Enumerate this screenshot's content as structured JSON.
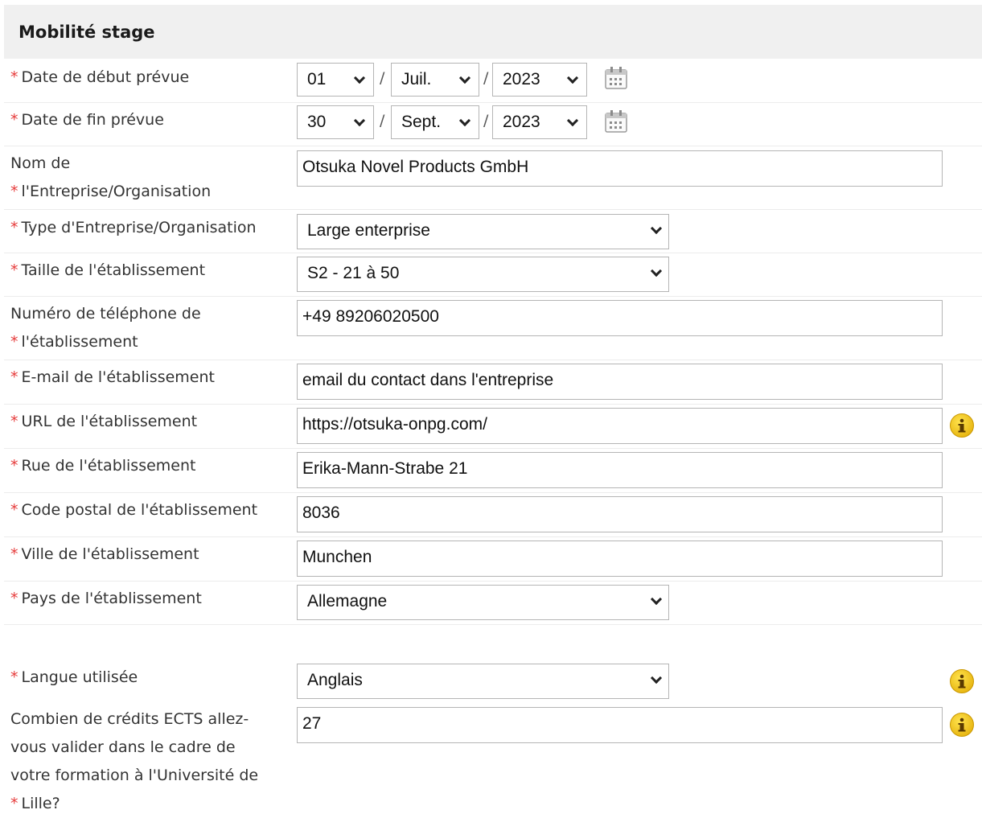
{
  "section": {
    "title": "Mobilité stage"
  },
  "colors": {
    "required": "#e63c3c",
    "info": "#f5c000",
    "header_bg": "#f0f0f0"
  },
  "fields": {
    "start_date": {
      "label": "Date de début prévue",
      "required": true,
      "day": "01",
      "month": "Juil.",
      "year": "2023",
      "sep": "/"
    },
    "end_date": {
      "label": "Date de fin prévue",
      "required": true,
      "day": "30",
      "month": "Sept.",
      "year": "2023",
      "sep": "/"
    },
    "org_name": {
      "label_line1": "Nom de",
      "label_line2": "l'Entreprise/Organisation",
      "required": true,
      "value": "Otsuka Novel Products GmbH"
    },
    "org_type": {
      "label": "Type d'Entreprise/Organisation",
      "required": true,
      "value": "Large enterprise"
    },
    "size": {
      "label": "Taille de l'établissement",
      "required": true,
      "value": "S2 - 21 à 50"
    },
    "phone": {
      "label_line1": "Numéro de téléphone de",
      "label_line2": "l'établissement",
      "required": true,
      "value": "+49 89206020500"
    },
    "email": {
      "label": "E-mail de l'établissement",
      "required": true,
      "value": "email du contact dans l'entreprise"
    },
    "url": {
      "label": "URL de l'établissement",
      "required": true,
      "value": "https://otsuka-onpg.com/",
      "info_icon": "info-icon"
    },
    "street": {
      "label": "Rue de l'établissement",
      "required": true,
      "value": "Erika-Mann-Strabe 21"
    },
    "postal": {
      "label": "Code postal de l'établissement",
      "required": true,
      "value": "8036"
    },
    "city": {
      "label": "Ville de l'établissement",
      "required": true,
      "value": "Munchen"
    },
    "country": {
      "label": "Pays de l'établissement",
      "required": true,
      "value": "Allemagne"
    },
    "language": {
      "label": "Langue utilisée",
      "required": true,
      "value": "Anglais",
      "info_icon": "info-icon"
    },
    "ects": {
      "label_line1": "Combien de crédits ECTS allez-",
      "label_line2": "vous valider dans le cadre de",
      "label_line3": "votre formation à l'Université de",
      "label_line4": "Lille?",
      "required": true,
      "value": "27",
      "info_icon": "info-icon"
    }
  },
  "required_marker": "*"
}
